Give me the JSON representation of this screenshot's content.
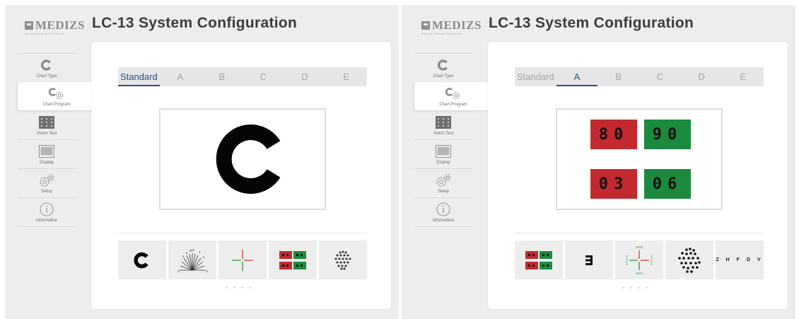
{
  "left": {
    "logo": {
      "name": "MEDIZS",
      "tagline": "Beyond Medical Excellence"
    },
    "title": "LC-13  System  Configuration",
    "sidebar": [
      {
        "label": "Chart Type",
        "icon": "landolt-c-icon"
      },
      {
        "label": "Chart Program",
        "icon": "chart-program-gear-icon",
        "active": true
      },
      {
        "label": "Vision Test",
        "icon": "vision-test-grid-icon"
      },
      {
        "label": "Display",
        "icon": "display-monitor-icon"
      },
      {
        "label": "Setup",
        "icon": "setup-gears-icon"
      },
      {
        "label": "Information",
        "icon": "info-icon"
      }
    ],
    "tabs": [
      "Standard",
      "A",
      "B",
      "C",
      "D",
      "E"
    ],
    "active_tab": "Standard",
    "preview": "landolt-c-chart",
    "thumbnails": [
      "landolt-c-thumb",
      "astigmatism-dial-thumb",
      "cross-target-thumb",
      "red-green-numbers-thumb",
      "dot-cluster-thumb"
    ],
    "dial_numbers": [
      "4",
      "5",
      "6",
      "12",
      "1",
      "2",
      "3",
      "3"
    ]
  },
  "right": {
    "logo": {
      "name": "MEDIZS",
      "tagline": "Beyond Medical Excellence"
    },
    "title": "LC-13  System  Configuration",
    "sidebar": [
      {
        "label": "Chart Type",
        "icon": "landolt-c-icon"
      },
      {
        "label": "Chart Program",
        "icon": "chart-program-gear-icon",
        "active": true
      },
      {
        "label": "Vision Test",
        "icon": "vision-test-grid-icon"
      },
      {
        "label": "Display",
        "icon": "display-monitor-icon"
      },
      {
        "label": "Setup",
        "icon": "setup-gears-icon"
      },
      {
        "label": "Information",
        "icon": "info-icon"
      }
    ],
    "tabs": [
      "Standard",
      "A",
      "B",
      "C",
      "D",
      "E"
    ],
    "active_tab": "A",
    "preview_numbers": {
      "red_top": "80",
      "green_top": "90",
      "red_bottom": "03",
      "green_bottom": "06"
    },
    "thumbnails": [
      "red-green-numbers-thumb",
      "tumbling-e-thumb",
      "cross-target-green-thumb",
      "dot-cluster-thumb",
      "snellen-letters-thumb"
    ],
    "snellen_letters": "Z H F D V"
  },
  "colors": {
    "red": "#c22a2f",
    "green": "#1b8a3f",
    "active_tab": "#2b4d86",
    "cross_red": "#d0302c",
    "cross_green": "#2a8c3c"
  }
}
